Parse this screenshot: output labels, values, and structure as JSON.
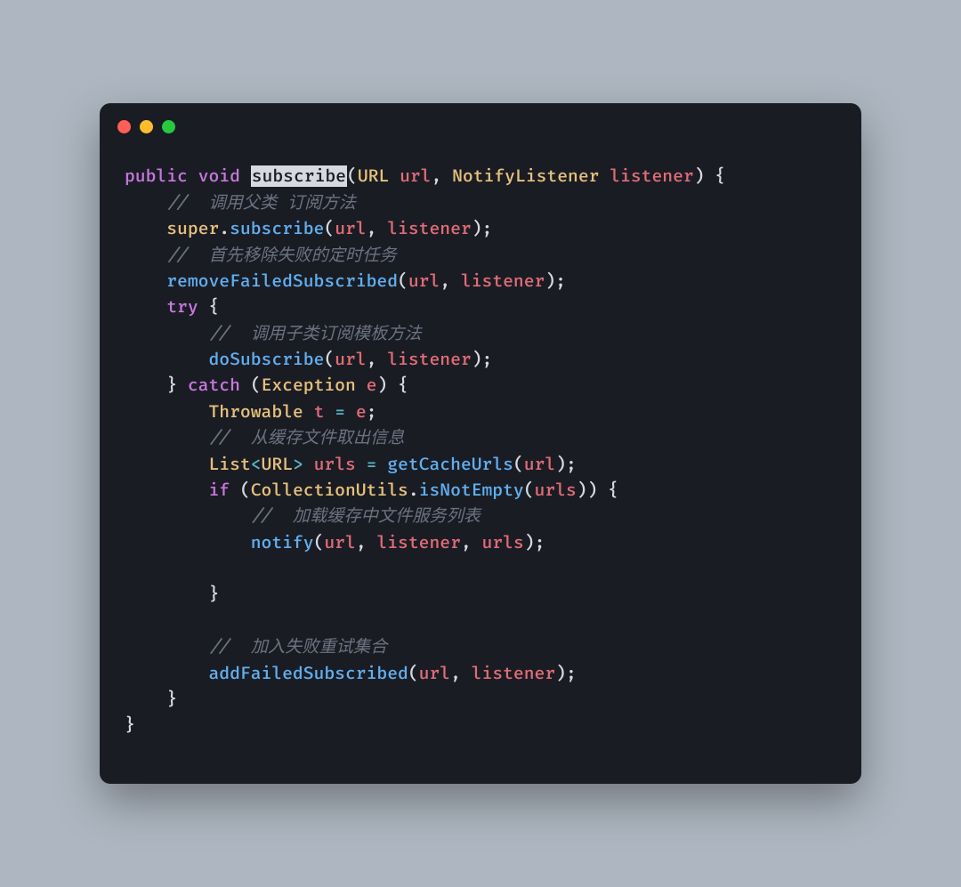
{
  "titlebar": {
    "red": "close",
    "yellow": "minimize",
    "green": "zoom"
  },
  "code": {
    "l1_public": "public",
    "l1_void": "void",
    "l1_subscribe": "subscribe",
    "l1_p1": "(",
    "l1_URL": "URL",
    "l1_url": "url",
    "l1_c": ",",
    "l1_NL": "NotifyListener",
    "l1_listener": "listener",
    "l1_p2": ")",
    "l1_brace": "{",
    "l2_cmt": "//  调用父类 订阅方法",
    "l3_super": "super",
    "l3_dot": ".",
    "l3_fn": "subscribe",
    "l3_args_url": "url",
    "l3_args_listener": "listener",
    "l4_cmt": "//  首先移除失败的定时任务",
    "l5_fn": "removeFailedSubscribed",
    "l5_url": "url",
    "l5_listener": "listener",
    "l6_try": "try",
    "l7_cmt": "//  调用子类订阅模板方法",
    "l8_fn": "doSubscribe",
    "l8_url": "url",
    "l8_listener": "listener",
    "l9_catch": "catch",
    "l9_Exception": "Exception",
    "l9_e": "e",
    "l10_Throwable": "Throwable",
    "l10_t": "t",
    "l10_eq": "=",
    "l10_e": "e",
    "l11_cmt": "//  从缓存文件取出信息",
    "l12_List": "List",
    "l12_lt": "<",
    "l12_URL": "URL",
    "l12_gt": ">",
    "l12_urls": "urls",
    "l12_eq": "=",
    "l12_fn": "getCacheUrls",
    "l12_url": "url",
    "l13_if": "if",
    "l13_CU": "CollectionUtils",
    "l13_dot": ".",
    "l13_fn": "isNotEmpty",
    "l13_urls": "urls",
    "l14_cmt": "//  加载缓存中文件服务列表",
    "l15_fn": "notify",
    "l15_url": "url",
    "l15_listener": "listener",
    "l15_urls": "urls",
    "l18_cmt": "//  加入失败重试集合",
    "l19_fn": "addFailedSubscribed",
    "l19_url": "url",
    "l19_listener": "listener"
  }
}
